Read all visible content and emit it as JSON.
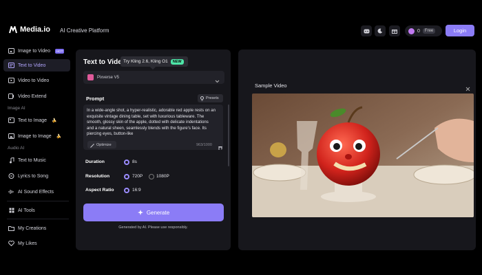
{
  "brand": {
    "name": "Media.io",
    "platform_label": "AI Creative Platform"
  },
  "header": {
    "icons": [
      "discord-icon",
      "moon-icon",
      "gift-icon"
    ],
    "credits": "0",
    "plan": "Free",
    "login_label": "Login"
  },
  "sidebar": {
    "items": [
      {
        "label": "Image to Video",
        "badge": "HOT",
        "icon": "image-video-icon"
      },
      {
        "label": "Text to Video",
        "active": true,
        "icon": "text-video-icon"
      },
      {
        "label": "Video to Video",
        "icon": "video-video-icon"
      },
      {
        "label": "Video Extend",
        "icon": "video-extend-icon"
      }
    ],
    "section_image": "Image AI",
    "image_items": [
      {
        "label": "Text to Image",
        "icon": "text-image-icon",
        "mark": "🍌"
      },
      {
        "label": "Image to Image",
        "icon": "image-image-icon",
        "mark": "🍌"
      }
    ],
    "section_audio": "Audio AI",
    "audio_items": [
      {
        "label": "Text to Music",
        "icon": "music-note-icon"
      },
      {
        "label": "Lyrics to Song",
        "icon": "lyrics-icon"
      },
      {
        "label": "AI Sound Effects",
        "icon": "sound-effects-icon"
      }
    ],
    "tools_label": "AI Tools",
    "creations_label": "My Creations",
    "likes_label": "My Likes"
  },
  "form": {
    "title": "Text to Video",
    "tooltip": "Try Kling 2.6, Kling O1",
    "tooltip_badge": "NEW",
    "model": "Pixverse V5",
    "prompt_label": "Prompt",
    "presets_label": "Presets",
    "prompt_text": "In a wide-angle shot, a hyper-realistic, adorable red apple rests on an exquisite vintage dining table, set with luxurious tableware. The smooth, glossy skin of the apple, dotted with delicate indentations and a natural sheen, seamlessly blends with the figure's face. Its piercing eyes, button-like",
    "optimize_label": "Optimize",
    "char_count": "963/1000",
    "duration_label": "Duration",
    "duration_value": "8s",
    "resolution_label": "Resolution",
    "resolution_options": [
      "720P",
      "1080P"
    ],
    "resolution_selected": "720P",
    "aspect_label": "Aspect Ratio",
    "aspect_value": "16:9",
    "generate_label": "Generate",
    "note": "Generated by AI. Please use responsibly."
  },
  "sample": {
    "title": "Sample Video"
  },
  "colors": {
    "accent": "#8b7cf6",
    "active_text": "#b3a6ff",
    "panel": "#17171c",
    "new_badge": "#4ee6a8"
  }
}
